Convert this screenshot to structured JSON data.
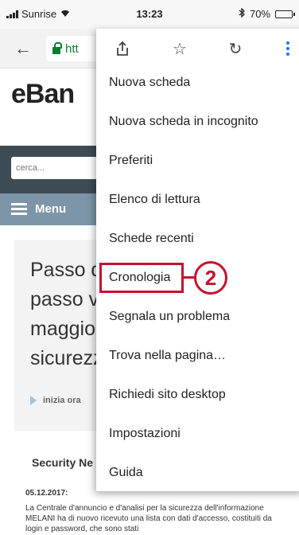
{
  "status_bar": {
    "carrier": "Sunrise",
    "time": "13:23",
    "battery": "70%",
    "battery_level": 0.7
  },
  "browser": {
    "url_fragment": "htt"
  },
  "website": {
    "logo": "eBan",
    "search_placeholder": "cerca...",
    "menu_label": "Menu",
    "hero_lines": [
      "Passo d",
      "passo v",
      "maggior",
      "sicurezz"
    ],
    "hero_cta": "inizia ora",
    "news_title": "Security Ne",
    "news_date": "05.12.2017:",
    "news_body": "La Centrale d'annuncio e d'analisi per la sicurezza dell'informazione MELANI ha di nuovo ricevuto una lista con dati d'accesso, costituiti da login e password, che sono stati"
  },
  "overflow_menu": {
    "icons": [
      "share-icon",
      "star-icon",
      "reload-icon",
      "more-icon"
    ],
    "items": [
      "Nuova scheda",
      "Nuova scheda in incognito",
      "Preferiti",
      "Elenco di lettura",
      "Schede recenti",
      "Cronologia",
      "Segnala un problema",
      "Trova nella pagina…",
      "Richiedi sito desktop",
      "Impostazioni",
      "Guida"
    ]
  },
  "annotation": {
    "step_number": "2",
    "color": "#c4122f"
  }
}
